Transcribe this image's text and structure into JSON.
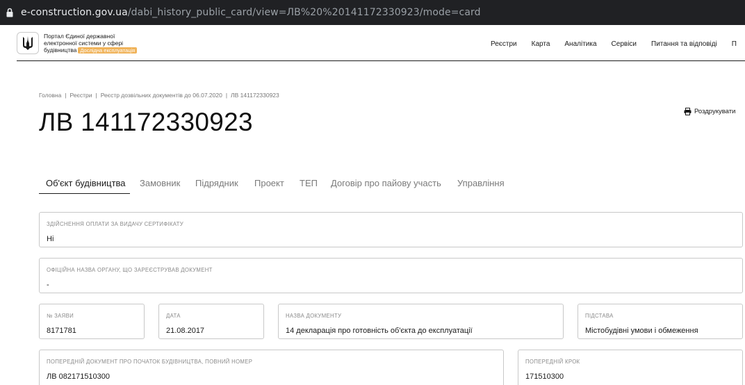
{
  "browser": {
    "url_host": "e-construction.gov.ua",
    "url_path": "/dabi_history_public_card/view=ЛВ%20%20141172330923/mode=card"
  },
  "header": {
    "logo_icon": "tryzub-icon",
    "brand_line1": "Портал Єдиної державної",
    "brand_line2": "електронної системи у сфері",
    "brand_line3": "будівництва",
    "badge": "Дослідна експлуатація",
    "nav": [
      "Реєстри",
      "Карта",
      "Аналітика",
      "Сервіси",
      "Питання та відповіді",
      "П"
    ]
  },
  "breadcrumb": [
    "Головна",
    "Реєстри",
    "Реєстр дозвільних документів до 06.07.2020",
    "ЛВ 141172330923"
  ],
  "title": "ЛВ 141172330923",
  "print_label": "Роздрукувати",
  "tabs": [
    "Об'єкт будівництва",
    "Замовник",
    "Підрядник",
    "Проект",
    "ТЕП",
    "Договір про пайову участь",
    "Управління"
  ],
  "fields": {
    "payment": {
      "label": "Здійснення оплати за видачу сертифікату",
      "value": "Ні"
    },
    "authority": {
      "label": "Офіційна назва органу, що зареєстрував документ",
      "value": "-"
    },
    "app_no": {
      "label": "№ заяви",
      "value": "8171781"
    },
    "date": {
      "label": "Дата",
      "value": "21.08.2017"
    },
    "doc_name": {
      "label": "Назва документу",
      "value": "14 декларація про готовність об'єкта до експлуатації"
    },
    "basis": {
      "label": "Підстава",
      "value": "Містобудівні умови і обмеження"
    },
    "prev_doc": {
      "label": "Попередній документ про початок будівництва, повний номер",
      "value": "ЛВ 082171510300"
    },
    "prev_step": {
      "label": "Попередній крок",
      "value": "171510300"
    }
  },
  "colors": {
    "badge": "#f0b35a",
    "browser_bar": "#202124"
  }
}
